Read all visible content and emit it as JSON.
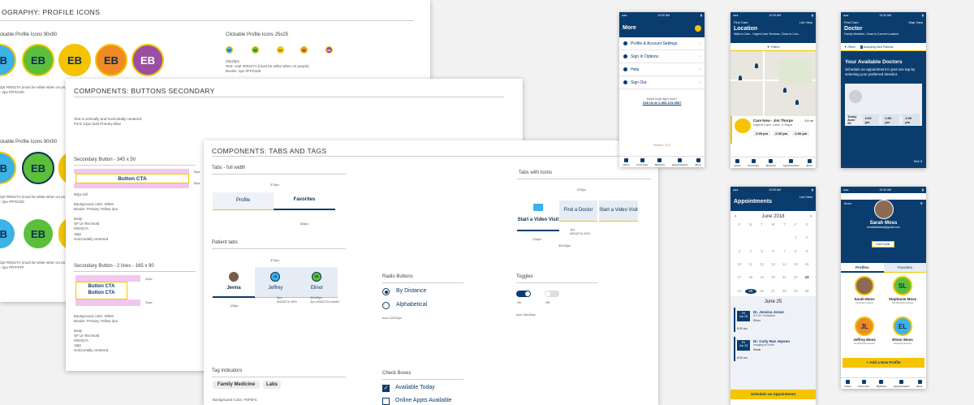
{
  "board1": {
    "title": "OGRAPHY: PROFILE ICONS",
    "sec1_label": "ckable Profile Icons 90x90",
    "sec2_label": "Clickable Profile Icons 25x25",
    "initials": "EB",
    "spec_small": "25x25px\nText: 12pt #00427A (must be white when on purple)\nBorder: 2px #FFD100",
    "spec_a": "2pt #00427A (must be white when on pu\n: 2px #FFD100",
    "sec3_label": "ckable Profile Icons 90x90",
    "spec_b": "2pt #00427A (must be white when on pu\n: 2px #FFD100",
    "spec_c": "2pt #00427A (must be white when on pu\n: 2px #FFFFFF",
    "colors": [
      "#3cb2e6",
      "#5cbf3c",
      "#f5c400",
      "#f08a24",
      "#9b4fa2"
    ]
  },
  "board2": {
    "title": "COMPONENTS: BUTTONS SECONDARY",
    "intro": "Text is vertically and horizontally centered.\nFont: 14px bold Primary Blue",
    "sec1": "Secondary Button - 345 x 50",
    "btn1": "Button CTA",
    "d15a": "15px",
    "d15b": "15px",
    "spec1": "50px tall\n\nBackground color: White\nBorder: Primary Yellow 2px\n\nBody\nSF UI Text Bold\n#00427A\n16pt\nHorizontally centered",
    "sec2": "Secondary Button - 2 lines - 165 x 90",
    "btn2a": "Button CTA",
    "btn2b": "Button CTA",
    "d20a": "20px",
    "d20b": "20px",
    "spec2": "Background color: White\nBorder: Primary Yellow 2px\n\nBody\nSF UI Text Bold\n#00427A\n16pt\nHorizontally centered"
  },
  "board3": {
    "title": "COMPONENTS: TABS AND TAGS",
    "tabs_full": "Tabs - full width",
    "w375a": "375px",
    "tab_profile": "Profile",
    "tab_favorites": "Favorites",
    "w188": "188px",
    "patient_tabs": "Patient tabs",
    "w375b": "375px",
    "pt": [
      {
        "initials": "",
        "name": "Jenna"
      },
      {
        "initials": "JB",
        "name": "Jeffrey"
      },
      {
        "initials": "EB",
        "name": "Elinor"
      }
    ],
    "w126a": "126px",
    "pt_note1": "1px\n#00427A 15%",
    "pt_note2": "40x40px\n2px #00427A border",
    "tabs_icons": "Tabs with Icons",
    "w375c": "375px",
    "ti_video": "Start a Video Visit",
    "ti_doctor": "Find a Doctor",
    "ti_start": "Start a Video Visit",
    "w126b": "126px",
    "ti_note1": "1px\n#00427A 15%",
    "ti_note2": "35x35px",
    "radio_title": "Radio Buttons",
    "radio1": "By Distance",
    "radio2": "Alphabetical",
    "radio_icon": "Icon 22x22px",
    "toggles": "Toggles",
    "on": "On",
    "off": "Off",
    "toggle_icon": "Icon 45x45px",
    "tag_ind": "Tag Indicators",
    "tag1": "Family Medicine",
    "tag2": "Labs",
    "tag_bg": "Background Color: F5F5FC",
    "check_title": "Check Boxes",
    "check1": "Available Today",
    "check2": "Online Appts Available"
  },
  "phone_more": {
    "time": "10:30 AM",
    "title": "More",
    "items": [
      "Profile & Account Settings",
      "Sign In Options",
      "Help",
      "Sign Out"
    ],
    "help": "Need help right now?",
    "call": "Call Us at 1-866-123-4567",
    "version": "Version: 3.10"
  },
  "phone_location": {
    "back": "Find Care",
    "right": "List View",
    "title": "Location",
    "sub": "Walk-in Care - Urgent Care Services, Close to Curr...",
    "filters": "Filters",
    "card_title": "Care Now - Jim Thorpe",
    "card_sub": "Urgent Care, Labs, X-Rays",
    "dist": "3.6 mi",
    "times": [
      "2:00 pm",
      "2:00 pm",
      "2:00 pm"
    ]
  },
  "phone_doctor": {
    "back": "Find Care",
    "right": "Map View",
    "title": "Doctor",
    "sub": "Family Medicine, Close to Current Location",
    "filters": "Filters",
    "accepting": "Accepting New Patients",
    "heading": "Your Available Doctors",
    "body": "Schedule an appointment in just one tap by selecting your preferred timeslot.",
    "today": "Today",
    "date": "June 28",
    "times": [
      "2:00 pm",
      "2:00 pm",
      "2:00 pm"
    ],
    "see": "See it"
  },
  "phone_appt": {
    "right": "List View",
    "title": "Appointments",
    "month": "June 2018",
    "days": [
      "S",
      "M",
      "T",
      "W",
      "T",
      "F",
      "S"
    ],
    "june": "June 25",
    "appts": [
      {
        "d": "Fri\nJun 25",
        "doc": "Dr. Jessica Jones",
        "sp": "A.R.M. Pediatrics",
        "pt": "Elinor",
        "t": "8:00 am"
      },
      {
        "d": "Fri\nJun 25",
        "doc": "Dr. Carly Rae Jepson",
        "sp": "Imaging at North",
        "pt": "Sarah",
        "t": "8:00 am"
      }
    ],
    "cta": "Schedule an Appointment"
  },
  "phone_profile": {
    "back": "More",
    "name": "Sarah Moss",
    "email": "emailAddress@gmail.com",
    "edit": "Edit Profile",
    "tabs": [
      "Profiles",
      "Favorites"
    ],
    "people": [
      {
        "n": "Sarah Moss",
        "s": "MyChart Linked",
        "i": ""
      },
      {
        "n": "Stephanie Moss",
        "s": "No MyChart Access",
        "i": "SL"
      },
      {
        "n": "Jeffrey Moss",
        "s": "No MyChart Access",
        "i": "JL"
      },
      {
        "n": "Elinor Moss",
        "s": "MyChart Access",
        "i": "EL"
      }
    ],
    "add": "Add a New Profile"
  },
  "tabbar": [
    "Home",
    "Find Care",
    "MyChart",
    "Appointments",
    "More"
  ]
}
